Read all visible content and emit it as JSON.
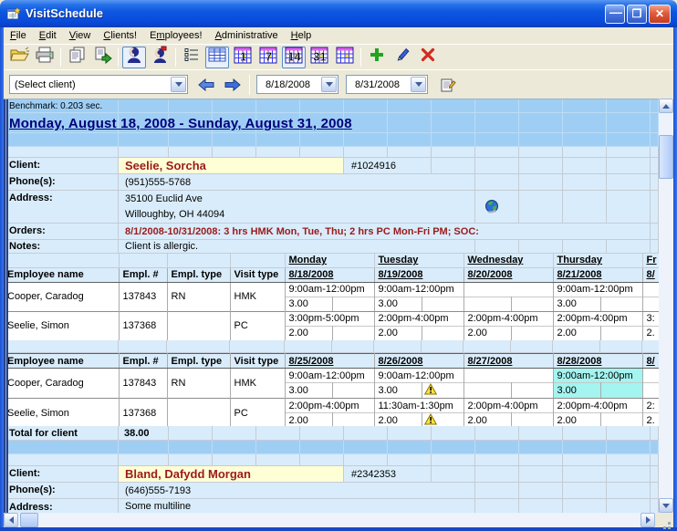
{
  "window": {
    "title": "VisitSchedule"
  },
  "menu": {
    "items": [
      {
        "label": "File",
        "accel": 0
      },
      {
        "label": "Edit",
        "accel": 0
      },
      {
        "label": "View",
        "accel": 0
      },
      {
        "label": "Clients!",
        "accel": 0
      },
      {
        "label": "Employees!",
        "accel": 1
      },
      {
        "label": "Administrative",
        "accel": 0
      },
      {
        "label": "Help",
        "accel": 0
      }
    ]
  },
  "toolbar": {
    "buttons": [
      {
        "icon": "open-folder-icon"
      },
      {
        "icon": "print-icon"
      },
      {
        "icon": "report-pages-icon",
        "sep_before": true
      },
      {
        "icon": "export-pages-icon"
      },
      {
        "icon": "client-person-icon",
        "sep_before": true,
        "pressed": true
      },
      {
        "icon": "employee-person-icon"
      },
      {
        "icon": "list-view-icon",
        "sep_before": true
      },
      {
        "icon": "grid-view-icon",
        "pressed": true
      },
      {
        "icon": "calendar-1-icon",
        "num": "1"
      },
      {
        "icon": "calendar-7-icon",
        "num": "7"
      },
      {
        "icon": "calendar-14-icon",
        "num": "14",
        "pressed": true
      },
      {
        "icon": "calendar-31-icon",
        "num": "31"
      },
      {
        "icon": "calendar-period-icon",
        "num": ""
      },
      {
        "icon": "add-icon",
        "sep_before": true
      },
      {
        "icon": "edit-icon"
      },
      {
        "icon": "delete-icon"
      }
    ]
  },
  "navbar": {
    "client_select": {
      "value": "(Select client)"
    },
    "date_from": {
      "value": "8/18/2008"
    },
    "date_to": {
      "value": "8/31/2008"
    }
  },
  "status": {
    "benchmark": "Benchmark: 0.203 sec."
  },
  "period_title": "Monday, August 18, 2008 - Sunday, August 31, 2008",
  "table": {
    "columns": [
      "Employee name",
      "Empl. #",
      "Empl. type",
      "Visit type"
    ]
  },
  "labels": {
    "client": "Client:",
    "phones": "Phone(s):",
    "address": "Address:",
    "orders": "Orders:",
    "notes": "Notes:"
  },
  "clients": [
    {
      "name": "Seelie, Sorcha",
      "id": "#1024916",
      "phone": "(951)555-5768",
      "address_line1": "35100 Euclid Ave",
      "address_line2": "Willoughby, OH 44094",
      "orders": "8/1/2008-10/31/2008: 3 hrs HMK Mon, Tue, Thu; 2 hrs PC Mon-Fri PM; SOC:",
      "notes": "Client is allergic.",
      "total_label": "Total for client",
      "total_value": "38.00",
      "weeks": [
        {
          "show_day_names": true,
          "days": [
            {
              "name": "Monday",
              "date": "8/18/2008"
            },
            {
              "name": "Tuesday",
              "date": "8/19/2008"
            },
            {
              "name": "Wednesday",
              "date": "8/20/2008"
            },
            {
              "name": "Thursday",
              "date": "8/21/2008"
            },
            {
              "name": "Fr",
              "date": "8/"
            }
          ],
          "rows": [
            {
              "name": "Cooper, Caradog",
              "empl_no": "137843",
              "empl_type": "RN",
              "visit_type": "HMK",
              "cells": [
                {
                  "time": "9:00am-12:00pm",
                  "hours": "3.00"
                },
                {
                  "time": "9:00am-12:00pm",
                  "hours": "3.00"
                },
                {
                  "time": "",
                  "hours": ""
                },
                {
                  "time": "9:00am-12:00pm",
                  "hours": "3.00"
                },
                {
                  "time": "",
                  "hours": ""
                }
              ]
            },
            {
              "name": "Seelie, Simon",
              "empl_no": "137368",
              "empl_type": "",
              "visit_type": "PC",
              "cells": [
                {
                  "time": "3:00pm-5:00pm",
                  "hours": "2.00"
                },
                {
                  "time": "2:00pm-4:00pm",
                  "hours": "2.00"
                },
                {
                  "time": "2:00pm-4:00pm",
                  "hours": "2.00"
                },
                {
                  "time": "2:00pm-4:00pm",
                  "hours": "2.00"
                },
                {
                  "time": "3:",
                  "hours": "2."
                }
              ]
            }
          ]
        },
        {
          "show_day_names": false,
          "days": [
            {
              "name": "",
              "date": "8/25/2008"
            },
            {
              "name": "",
              "date": "8/26/2008"
            },
            {
              "name": "",
              "date": "8/27/2008"
            },
            {
              "name": "",
              "date": "8/28/2008"
            },
            {
              "name": "",
              "date": "8/"
            }
          ],
          "rows": [
            {
              "name": "Cooper, Caradog",
              "empl_no": "137843",
              "empl_type": "RN",
              "visit_type": "HMK",
              "cells": [
                {
                  "time": "9:00am-12:00pm",
                  "hours": "3.00"
                },
                {
                  "time": "9:00am-12:00pm",
                  "hours": "3.00",
                  "warning": true
                },
                {
                  "time": "",
                  "hours": ""
                },
                {
                  "time": "9:00am-12:00pm",
                  "hours": "3.00",
                  "highlight": true
                },
                {
                  "time": "",
                  "hours": ""
                }
              ]
            },
            {
              "name": "Seelie, Simon",
              "empl_no": "137368",
              "empl_type": "",
              "visit_type": "PC",
              "cells": [
                {
                  "time": "2:00pm-4:00pm",
                  "hours": "2.00"
                },
                {
                  "time": "11:30am-1:30pm",
                  "hours": "2.00",
                  "warning": true
                },
                {
                  "time": "2:00pm-4:00pm",
                  "hours": "2.00"
                },
                {
                  "time": "2:00pm-4:00pm",
                  "hours": "2.00"
                },
                {
                  "time": "2:",
                  "hours": "2."
                }
              ]
            }
          ]
        }
      ]
    },
    {
      "name": "Bland, Dafydd Morgan",
      "id": "#2342353",
      "phone": "(646)555-7193",
      "address_line1": "Some multiline"
    }
  ],
  "colors": {
    "highlight_cyan": "#A4F4F0",
    "client_name_bg": "#FFFFD5",
    "client_name_text": "#9B1A1A",
    "band_medium": "#9FCEF5",
    "band_light": "#D9ECFB"
  }
}
